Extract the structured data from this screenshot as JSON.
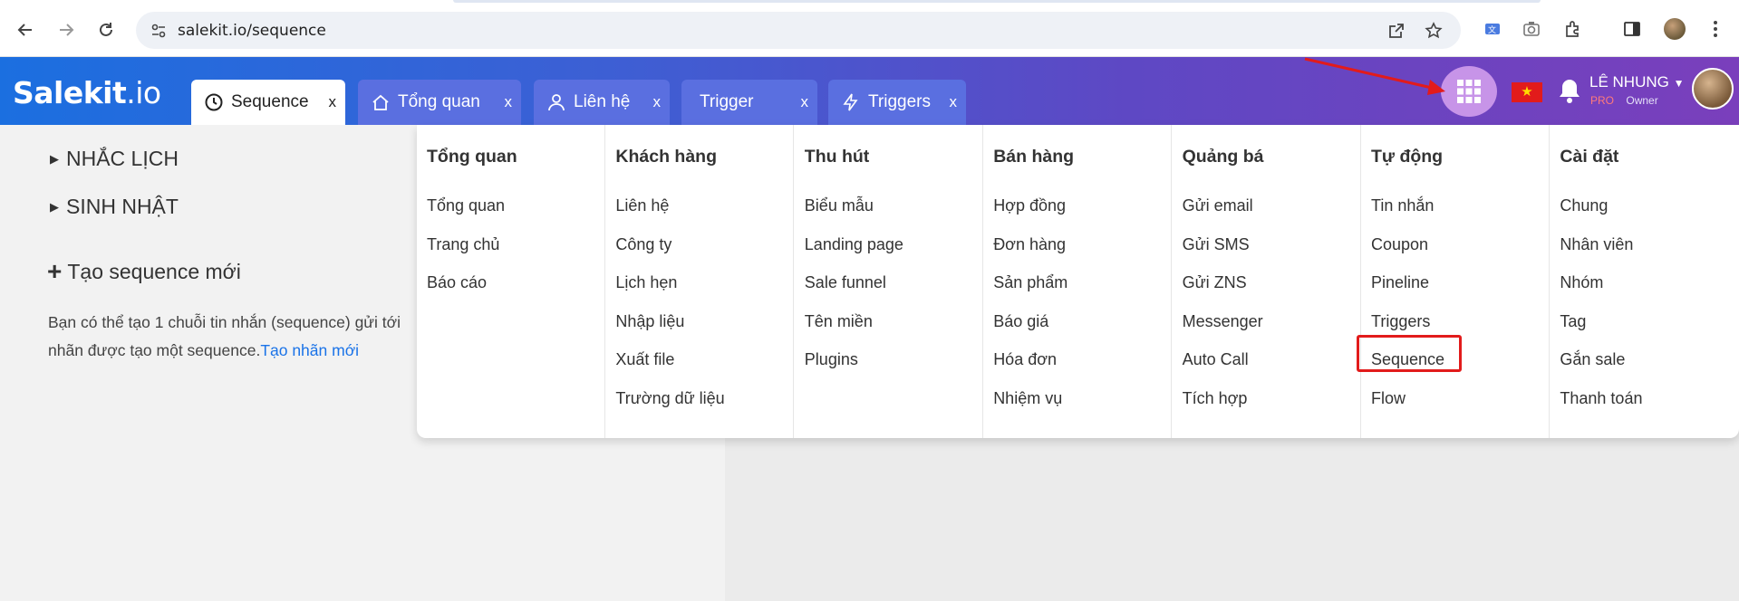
{
  "browser": {
    "url": "salekit.io/sequence"
  },
  "app": {
    "logo_main": "Salekit",
    "logo_io": ".io",
    "tabs": [
      {
        "label": "Sequence",
        "close": "x",
        "icon": "clock-icon",
        "active": true
      },
      {
        "label": "Tổng quan",
        "close": "x",
        "icon": "home-icon",
        "active": false
      },
      {
        "label": "Liên hệ",
        "close": "x",
        "icon": "user-icon",
        "active": false
      },
      {
        "label": "Trigger",
        "close": "x",
        "icon": "",
        "active": false
      },
      {
        "label": "Triggers",
        "close": "x",
        "icon": "bolt-icon",
        "active": false
      }
    ],
    "user": {
      "name": "LÊ NHUNG",
      "plan": "PRO",
      "role": "Owner"
    },
    "colors": {
      "header_start": "#1b6fe0",
      "header_end": "#7a3fbc",
      "link": "#1a73e8",
      "highlight": "#e21b1b"
    }
  },
  "page": {
    "sections": [
      "NHẮC LỊCH",
      "SINH NHẬT"
    ],
    "new_sequence": "Tạo sequence mới",
    "description": "Bạn có thể tạo 1 chuỗi tin nhắn (sequence) gửi tới",
    "description_line2": "nhãn được tạo một sequence.",
    "description_link": "Tạo nhãn mới"
  },
  "menu": {
    "columns": [
      {
        "title": "Tổng quan",
        "items": [
          "Tổng quan",
          "Trang chủ",
          "Báo cáo"
        ]
      },
      {
        "title": "Khách hàng",
        "items": [
          "Liên hệ",
          "Công ty",
          "Lịch hẹn",
          "Nhập liệu",
          "Xuất file",
          "Trường dữ liệu"
        ]
      },
      {
        "title": "Thu hút",
        "items": [
          "Biểu mẫu",
          "Landing page",
          "Sale funnel",
          "Tên miền",
          "Plugins"
        ]
      },
      {
        "title": "Bán hàng",
        "items": [
          "Hợp đồng",
          "Đơn hàng",
          "Sản phẩm",
          "Báo giá",
          "Hóa đơn",
          "Nhiệm vụ"
        ]
      },
      {
        "title": "Quảng bá",
        "items": [
          "Gửi email",
          "Gửi SMS",
          "Gửi ZNS",
          "Messenger",
          "Auto Call",
          "Tích hợp"
        ]
      },
      {
        "title": "Tự động",
        "items": [
          "Tin nhắn",
          "Coupon",
          "Pineline",
          "Triggers",
          "Sequence",
          "Flow"
        ]
      },
      {
        "title": "Cài đặt",
        "items": [
          "Chung",
          "Nhân viên",
          "Nhóm",
          "Tag",
          "Gắn sale",
          "Thanh toán"
        ]
      }
    ]
  }
}
